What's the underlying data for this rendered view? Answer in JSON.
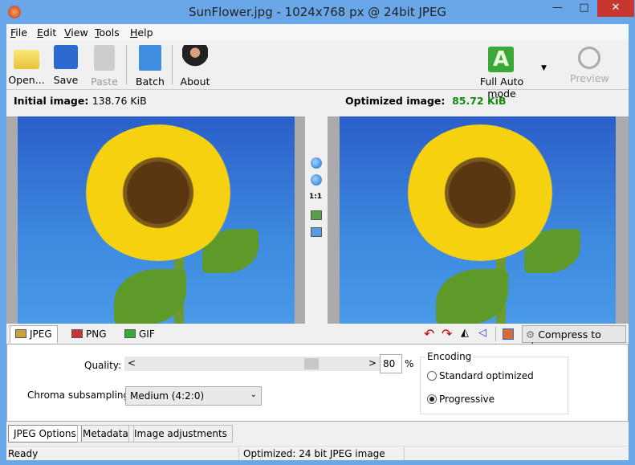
{
  "window": {
    "title": "SunFlower.jpg - 1024x768 px @ 24bit JPEG",
    "minimize": "—",
    "maximize": "□",
    "close": "✕"
  },
  "menu": [
    "File",
    "Edit",
    "View",
    "Tools",
    "Help"
  ],
  "toolbar": {
    "open": "Open...",
    "save": "Save",
    "paste": "Paste",
    "batch": "Batch",
    "about": "About",
    "auto_mode": "Full Auto mode",
    "auto_letter": "A",
    "preview": "Preview"
  },
  "images": {
    "initial_label": "Initial image:",
    "initial_size": "138.76 KiB",
    "optimized_label": "Optimized image:",
    "optimized_size": "85.72 KiB",
    "zoom_1to1": "1:1"
  },
  "format_tabs": [
    "JPEG",
    "PNG",
    "GIF"
  ],
  "compress_button": "Compress to size",
  "options": {
    "quality_label": "Quality:",
    "quality_value": "80",
    "percent": "%",
    "slider_left": "<",
    "slider_right": ">",
    "chroma_label": "Chroma subsampling:",
    "chroma_value": "Medium (4:2:0)",
    "encoding_title": "Encoding",
    "encoding_options": [
      "Standard optimized",
      "Progressive"
    ],
    "encoding_selected": "Progressive"
  },
  "bottom_tabs": [
    "JPEG Options",
    "Metadata",
    "Image adjustments"
  ],
  "status": {
    "left": "Ready",
    "middle": "Optimized: 24 bit JPEG image"
  },
  "colors": {
    "accent": "#6aa7e8",
    "optimized_size": "#138a13",
    "auto_mode": "#3aa83a"
  }
}
